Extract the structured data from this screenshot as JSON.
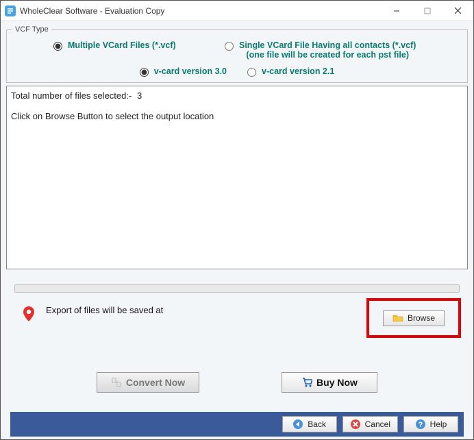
{
  "window": {
    "title": "WholeClear Software - Evaluation Copy"
  },
  "vcf_type": {
    "legend": "VCF Type",
    "multiple_label": "Multiple VCard Files (*.vcf)",
    "single_label_line1": "Single VCard File Having all contacts (*.vcf)",
    "single_label_line2": "(one file will be created for each pst file)",
    "version30": "v-card version 3.0",
    "version21": "v-card version 2.1"
  },
  "log": {
    "total_label": "Total number of files selected:-",
    "total_value": "3",
    "instruction": "Click on Browse Button to select the output location"
  },
  "export": {
    "label": "Export of files will be saved at",
    "browse_label": "Browse"
  },
  "buttons": {
    "convert": "Convert Now",
    "buy": "Buy Now",
    "back": "Back",
    "cancel": "Cancel",
    "help": "Help"
  }
}
